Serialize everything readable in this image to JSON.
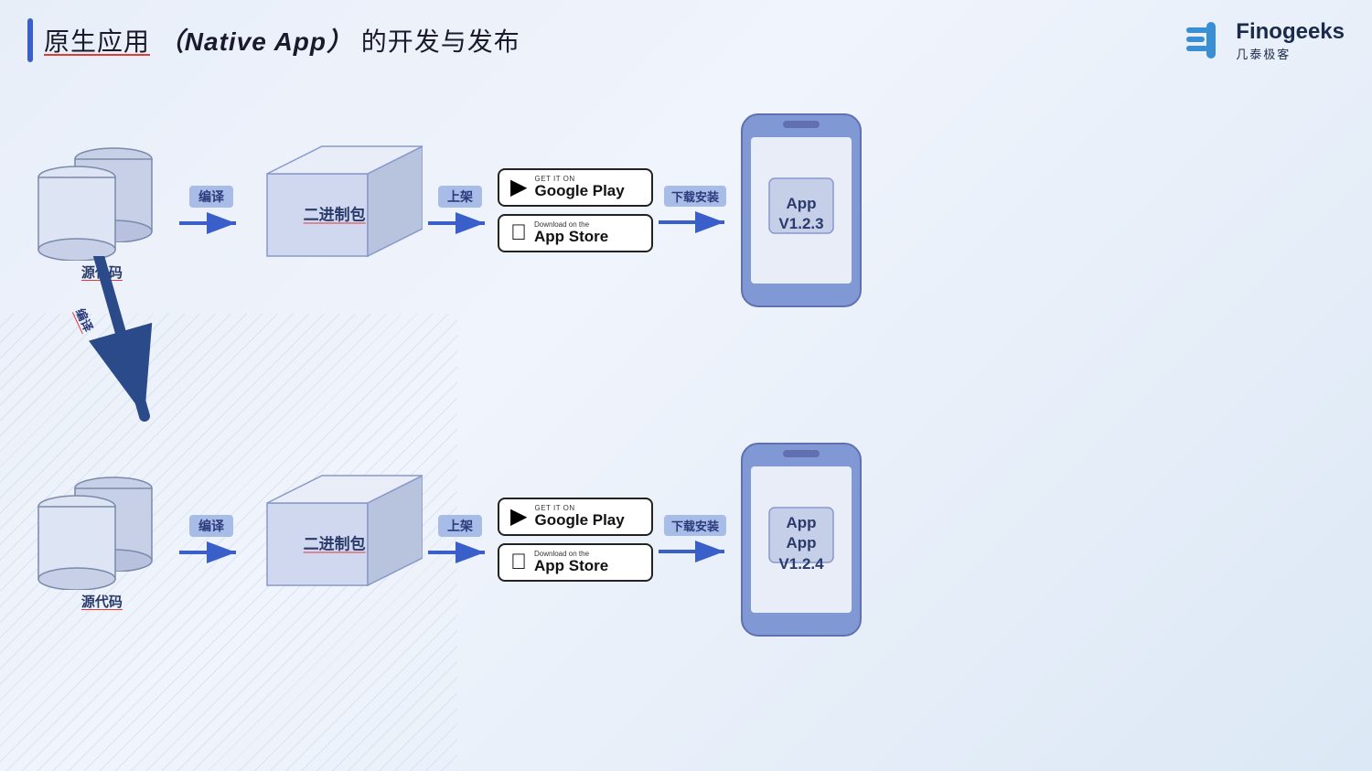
{
  "header": {
    "title_prefix": "原生应用",
    "title_bold": "（Native App）",
    "title_suffix": "的开发与发布",
    "logo_name": "Finogeeks",
    "logo_sub": "几泰极客"
  },
  "row1": {
    "source_label": "源代码",
    "compile_label": "编译",
    "binary_label": "二进制包",
    "publish_label": "上架",
    "download_label": "下载安装",
    "google_play_small": "GET IT ON",
    "google_play_big": "Google Play",
    "app_store_small": "Download on the",
    "app_store_big": "App Store",
    "app_version": "App\nV1.2.3"
  },
  "row2": {
    "source_label": "源代码",
    "compile_label": "编译",
    "binary_label": "二进制包",
    "publish_label": "上架",
    "download_label": "下载安装",
    "google_play_small": "GET IT ON",
    "google_play_big": "Google Play",
    "app_store_small": "Download on the",
    "app_store_big": "App Store",
    "app_version": "App\nV1.2.4"
  },
  "diagonal": {
    "label": "编译"
  },
  "colors": {
    "accent": "#3a5fc8",
    "dark_blue": "#2a3a7a",
    "box_fill": "#c5cfe8",
    "box_stroke": "#7a8fc8",
    "phone_fill": "#8099d4",
    "arrow_fill": "#3a5fc8",
    "red_underline": "#e53935"
  }
}
